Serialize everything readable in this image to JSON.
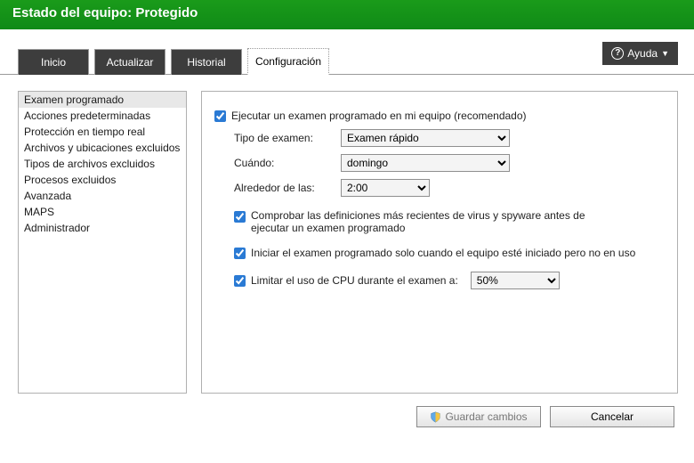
{
  "header": {
    "title": "Estado del equipo: Protegido"
  },
  "tabs": {
    "inicio": "Inicio",
    "actualizar": "Actualizar",
    "historial": "Historial",
    "configuracion": "Configuración"
  },
  "help": {
    "label": "Ayuda"
  },
  "sidebar": {
    "items": [
      "Examen programado",
      "Acciones predeterminadas",
      "Protección en tiempo real",
      "Archivos y ubicaciones excluidos",
      "Tipos de archivos excluidos",
      "Procesos excluidos",
      "Avanzada",
      "MAPS",
      "Administrador"
    ],
    "selected_index": 0
  },
  "pane": {
    "run_scheduled": "Ejecutar un examen programado en mi equipo (recomendado)",
    "scan_type_label": "Tipo de examen:",
    "scan_type_value": "Examen rápido",
    "when_label": "Cuándo:",
    "when_value": "domingo",
    "around_label": "Alrededor de las:",
    "around_value": "2:00",
    "check_defs": "Comprobar las definiciones más recientes de virus y spyware antes de ejecutar un examen programado",
    "start_idle": "Iniciar el examen programado solo cuando el equipo esté iniciado pero no en uso",
    "limit_cpu": "Limitar el uso de CPU durante el examen a:",
    "cpu_value": "50%"
  },
  "footer": {
    "save": "Guardar cambios",
    "cancel": "Cancelar"
  }
}
